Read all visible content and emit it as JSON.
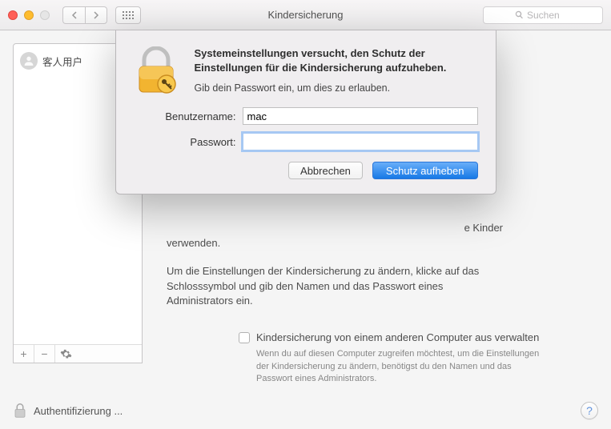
{
  "toolbar": {
    "title": "Kindersicherung",
    "search_placeholder": "Suchen"
  },
  "user_list": {
    "items": [
      {
        "name": "客人用户"
      }
    ]
  },
  "content": {
    "paragraph1_tail": "e Kinder",
    "paragraph1_line2": "verwenden.",
    "paragraph2": "Um die Einstellungen der Kindersicherung zu ändern, klicke auf das Schlosssymbol und gib den Namen und das Passwort eines Administrators ein.",
    "checkbox_label": "Kindersicherung von einem anderen Computer aus verwalten",
    "hint": "Wenn du auf diesen Computer zugreifen möchtest, um die Einstellungen der Kindersicherung zu ändern, benötigst du den Namen und das Passwort eines Administrators."
  },
  "footer": {
    "auth_label": "Authentifizierung ..."
  },
  "sheet": {
    "title": "Systemeinstellungen versucht, den Schutz der Einstellungen für die Kindersicherung aufzuheben.",
    "subtitle": "Gib dein Passwort ein, um dies zu erlauben.",
    "username_label": "Benutzername:",
    "username_value": "mac",
    "password_label": "Passwort:",
    "password_value": "",
    "cancel": "Abbrechen",
    "confirm": "Schutz aufheben"
  }
}
